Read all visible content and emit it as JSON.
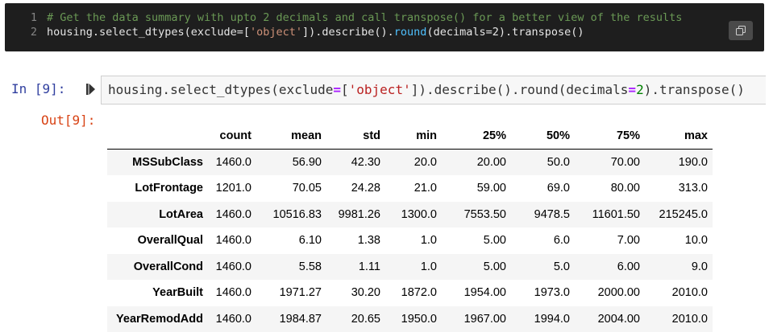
{
  "code_block": {
    "lines": [
      {
        "number": "1",
        "comment": "# Get the data summary with upto 2 decimals and call transpose() for a better view of the results"
      },
      {
        "number": "2",
        "pre": "housing.select_dtypes(exclude=[",
        "string": "'object'",
        "mid": "]).describe().",
        "func": "round",
        "post": "(decimals=2).transpose()"
      }
    ],
    "copy_icon": "copy-icon"
  },
  "cell": {
    "in_prompt": "In [9]:",
    "run_icon": "run-cell-icon",
    "code": {
      "part1": "housing.select_dtypes(exclude",
      "op1": "=",
      "part2": "[",
      "string": "'object'",
      "part3": "]).describe().round(decimals",
      "op2": "=",
      "number": "2",
      "part4": ").transpose()"
    },
    "out_prompt": "Out[9]:"
  },
  "table": {
    "columns": [
      "count",
      "mean",
      "std",
      "min",
      "25%",
      "50%",
      "75%",
      "max"
    ],
    "rows": [
      {
        "index": "MSSubClass",
        "values": [
          "1460.0",
          "56.90",
          "42.30",
          "20.0",
          "20.00",
          "50.0",
          "70.00",
          "190.0"
        ]
      },
      {
        "index": "LotFrontage",
        "values": [
          "1201.0",
          "70.05",
          "24.28",
          "21.0",
          "59.00",
          "69.0",
          "80.00",
          "313.0"
        ]
      },
      {
        "index": "LotArea",
        "values": [
          "1460.0",
          "10516.83",
          "9981.26",
          "1300.0",
          "7553.50",
          "9478.5",
          "11601.50",
          "215245.0"
        ]
      },
      {
        "index": "OverallQual",
        "values": [
          "1460.0",
          "6.10",
          "1.38",
          "1.0",
          "5.00",
          "6.0",
          "7.00",
          "10.0"
        ]
      },
      {
        "index": "OverallCond",
        "values": [
          "1460.0",
          "5.58",
          "1.11",
          "1.0",
          "5.00",
          "5.0",
          "6.00",
          "9.0"
        ]
      },
      {
        "index": "YearBuilt",
        "values": [
          "1460.0",
          "1971.27",
          "30.20",
          "1872.0",
          "1954.00",
          "1973.0",
          "2000.00",
          "2010.0"
        ]
      },
      {
        "index": "YearRemodAdd",
        "values": [
          "1460.0",
          "1984.87",
          "20.65",
          "1950.0",
          "1967.00",
          "1994.0",
          "2004.00",
          "2010.0"
        ]
      }
    ]
  },
  "colors": {
    "code_bg": "#1e1e1e",
    "comment": "#6a9955",
    "in_prompt": "#303f9f",
    "out_prompt": "#d84315",
    "stripe": "#f5f5f5"
  }
}
